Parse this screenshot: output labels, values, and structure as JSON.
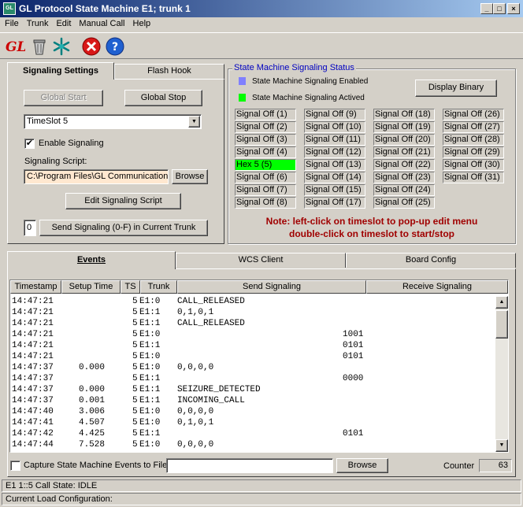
{
  "window": {
    "title": "GL Protocol State Machine  E1; trunk 1",
    "icon_text": "GL"
  },
  "menu": [
    "File",
    "Trunk",
    "Edit",
    "Manual Call",
    "Help"
  ],
  "tabs_left": {
    "active": "Signaling Settings",
    "other": "Flash Hook"
  },
  "settings": {
    "global_start": "Global Start",
    "global_stop": "Global Stop",
    "timeslot": "TimeSlot 5",
    "enable_signaling": "Enable Signaling",
    "script_label": "Signaling Script:",
    "script_path": "C:\\Program Files\\GL Communications",
    "browse": "Browse",
    "edit_script": "Edit Signaling Script",
    "send_value": "0",
    "send_button": "Send Signaling (0-F) in Current Trunk"
  },
  "status": {
    "group_title": "State Machine Signaling Status",
    "legend_enabled": "State Machine Signaling Enabled",
    "legend_actived": "State Machine Signaling Actived",
    "display_binary": "Display Binary",
    "colors": {
      "enabled": "#8080ff",
      "actived": "#00ff00"
    },
    "slots": [
      "Signal Off (1)",
      "Signal Off (2)",
      "Signal Off (3)",
      "Signal Off (4)",
      "Hex 5 (5)",
      "Signal Off (6)",
      "Signal Off (7)",
      "Signal Off (8)",
      "Signal Off (9)",
      "Signal Off (10)",
      "Signal Off (11)",
      "Signal Off (12)",
      "Signal Off (13)",
      "Signal Off (14)",
      "Signal Off (15)",
      "Signal Off (17)",
      "Signal Off (18)",
      "Signal Off (19)",
      "Signal Off (20)",
      "Signal Off (21)",
      "Signal Off (22)",
      "Signal Off (23)",
      "Signal Off (24)",
      "Signal Off (25)",
      "Signal Off (26)",
      "Signal Off (27)",
      "Signal Off (28)",
      "Signal Off (29)",
      "Signal Off (30)",
      "Signal Off (31)"
    ],
    "note1": "Note: left-click on timeslot to pop-up edit menu",
    "note2": "double-click on timeslot to start/stop"
  },
  "bottom_tabs": [
    "Events",
    "WCS Client",
    "Board Config"
  ],
  "events": {
    "columns": [
      "Timestamp",
      "Setup Time",
      "TS",
      "Trunk",
      "Send Signaling",
      "Receive Signaling"
    ],
    "rows": [
      [
        "14:47:21",
        "",
        "5",
        "E1:0",
        "CALL_RELEASED",
        ""
      ],
      [
        "14:47:21",
        "",
        "5",
        "E1:1",
        "0,1,0,1",
        ""
      ],
      [
        "14:47:21",
        "",
        "5",
        "E1:1",
        "CALL_RELEASED",
        ""
      ],
      [
        "14:47:21",
        "",
        "5",
        "E1:0",
        "",
        "1001"
      ],
      [
        "14:47:21",
        "",
        "5",
        "E1:1",
        "",
        "0101"
      ],
      [
        "14:47:21",
        "",
        "5",
        "E1:0",
        "",
        "0101"
      ],
      [
        "14:47:37",
        "0.000",
        "5",
        "E1:0",
        "0,0,0,0",
        ""
      ],
      [
        "14:47:37",
        "",
        "5",
        "E1:1",
        "",
        "0000"
      ],
      [
        "14:47:37",
        "0.000",
        "5",
        "E1:1",
        "SEIZURE_DETECTED",
        ""
      ],
      [
        "14:47:37",
        "0.001",
        "5",
        "E1:1",
        "INCOMING_CALL",
        ""
      ],
      [
        "14:47:40",
        "3.006",
        "5",
        "E1:0",
        "0,0,0,0",
        ""
      ],
      [
        "14:47:41",
        "4.507",
        "5",
        "E1:0",
        "0,1,0,1",
        ""
      ],
      [
        "14:47:42",
        "4.425",
        "5",
        "E1:1",
        "",
        "0101"
      ],
      [
        "14:47:44",
        "7.528",
        "5",
        "E1:0",
        "0,0,0,0",
        ""
      ]
    ],
    "capture_label": "Capture State Machine Events to File",
    "browse": "Browse",
    "counter_label": "Counter",
    "counter_value": "63"
  },
  "statusbar": {
    "call_state": "E1 1::5 Call State: IDLE",
    "load_config": "Current Load Configuration:"
  }
}
